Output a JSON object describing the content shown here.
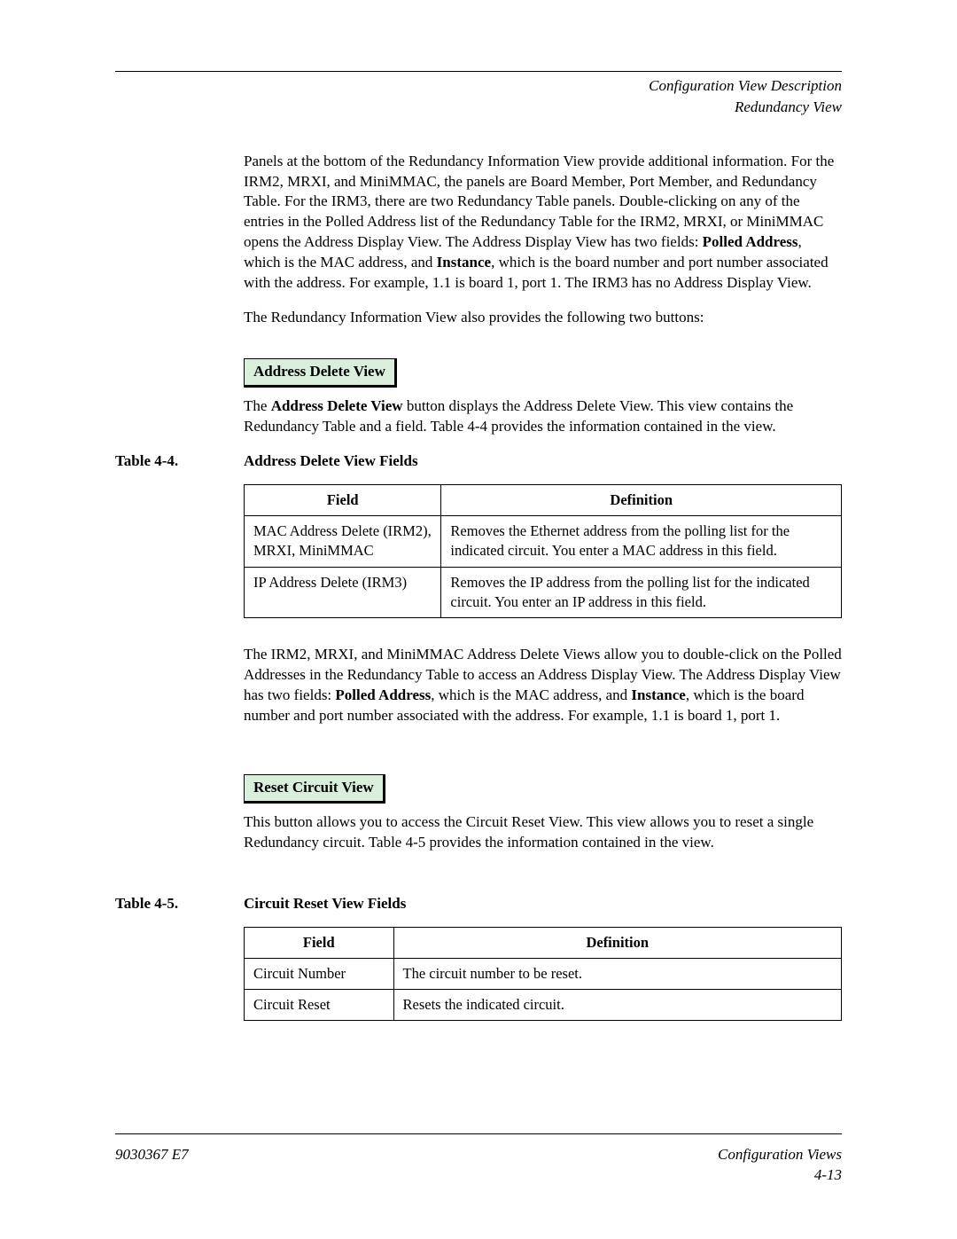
{
  "header": {
    "line1": "Configuration View Description",
    "line2": "Redundancy View"
  },
  "body": {
    "p1a": "Panels at the bottom of the Redundancy Information View provide additional information. For the IRM2, MRXI, and MiniMMAC, the panels are Board Member, Port Member, and Redundancy Table. For the IRM3, there are two Redundancy Table panels. Double-clicking on any of the entries in the Polled Address list of the Redundancy Table for the IRM2, MRXI, or MiniMMAC opens the Address Display View. The Address Display View has two fields: ",
    "p1b_bold": "Polled Address",
    "p1c": ", which is the MAC address, and ",
    "p1d_bold": "Instance",
    "p1e": ", which is the board number and port number associated with the address. For example, 1.1 is board 1, port 1. The IRM3 has no Address Display View.",
    "p2": "The Redundancy Information View also provides the following two buttons:",
    "btn1": "Address Delete View",
    "p3a": "The ",
    "p3b_bold": "Address Delete View",
    "p3c": " button displays the Address Delete View. This view contains the Redundancy Table and a field. Table 4-4 provides the information contained in the view.",
    "p4a": "The IRM2, MRXI, and MiniMMAC Address Delete Views allow you to double-click on the Polled Addresses in the Redundancy Table to access an Address Display View. The Address Display View has two fields: ",
    "p4b_bold": "Polled Address",
    "p4c": ", which is the MAC address, and ",
    "p4d_bold": "Instance",
    "p4e": ", which is the board number and port number associated with the address. For example, 1.1 is board 1, port 1.",
    "btn2": "Reset Circuit View",
    "p5": "This button allows you to access the Circuit Reset View. This view allows you to reset a single Redundancy circuit. Table 4-5 provides the information contained in the view."
  },
  "table44": {
    "label": "Table 4-4.",
    "title": "Address Delete View Fields",
    "head_field": "Field",
    "head_def": "Definition",
    "r1f": "MAC Address Delete (IRM2), MRXI, MiniMMAC",
    "r1d": "Removes the Ethernet address from the polling list for the indicated circuit. You enter a MAC address in this field.",
    "r2f": "IP Address Delete (IRM3)",
    "r2d": "Removes the IP address from the polling list for the indicated circuit. You enter an IP address in this field."
  },
  "table45": {
    "label": "Table 4-5.",
    "title": "Circuit Reset View Fields",
    "head_field": "Field",
    "head_def": "Definition",
    "r1f": "Circuit Number",
    "r1d": "The circuit number to be reset.",
    "r2f": "Circuit Reset",
    "r2d": "Resets the indicated circuit."
  },
  "footer": {
    "left": "9030367 E7",
    "right1": "Configuration Views",
    "right2": "4-13"
  }
}
